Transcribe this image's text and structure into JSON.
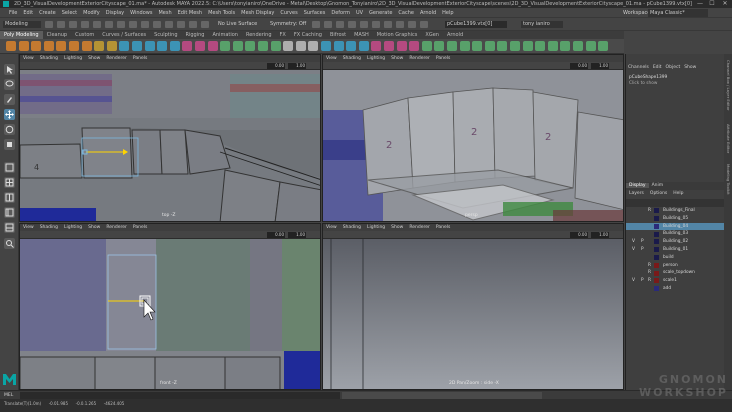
{
  "window": {
    "title": "2D_3D_VisualDevelopmentExteriorCityscape_01.ma* - Autodesk MAYA 2022.5: C:\\Users\\tonyianiro\\OneDrive - Metal\\Desktop\\Gnomon_Tonyianiro\\2D_3D_VisualDevelopmentExteriorCityscape\\scenes\\2D_3D_VisualDevelopmentExteriorCityscape_01.ma - pCube1399.vtx[0]",
    "min_glyph": "—",
    "max_glyph": "☐",
    "close_glyph": "✕"
  },
  "menubar": {
    "items": [
      "File",
      "Edit",
      "Create",
      "Select",
      "Modify",
      "Display",
      "Windows",
      "Mesh",
      "Edit Mesh",
      "Mesh Tools",
      "Mesh Display",
      "Curves",
      "Surfaces",
      "Deform",
      "UV",
      "Generate",
      "Cache",
      "Arnold",
      "Help"
    ],
    "workspace_label": "Workspace:",
    "workspace_value": "Maya Classic*"
  },
  "statusline": {
    "mode": "Modeling",
    "no_live_surface": "No Live Surface",
    "symmetry": "Symmetry: Off",
    "object_field": "pCube1399.vtx[0]",
    "account": "tony ianiro"
  },
  "shelf": {
    "tabs": [
      "Poly Modeling",
      "Cleanup",
      "Custom",
      "Curves / Surfaces",
      "Sculpting",
      "Rigging",
      "Animation",
      "Rendering",
      "FX",
      "FX Caching",
      "Bifrost",
      "MASH",
      "Motion Graphics",
      "XGen",
      "Arnold"
    ],
    "active_tab": 0
  },
  "viewports": {
    "menu": [
      "View",
      "Shading",
      "Lighting",
      "Show",
      "Renderer",
      "Panels"
    ],
    "field_a": "0.00",
    "field_b": "1.00",
    "top_label": "top -Z",
    "persp_label": "persp",
    "front_label": "front -Z",
    "pan_label": "2D Pan/Zoom : side -X"
  },
  "channel_box": {
    "tabs": [
      "Channels",
      "Edit",
      "Object",
      "Show"
    ],
    "object_name": "pCubeShape1399",
    "hint": "Click to show"
  },
  "layer_editor": {
    "tabs": [
      "Display",
      "Anim"
    ],
    "menu": [
      "Layers",
      "Options",
      "Help"
    ],
    "layers": [
      {
        "v": "",
        "p": "",
        "r": "R",
        "color": "#1a1a4a",
        "name": "Buildings_Final",
        "selected": false
      },
      {
        "v": "",
        "p": "",
        "r": "",
        "color": "#1a1a4a",
        "name": "Building_05",
        "selected": false
      },
      {
        "v": "",
        "p": "",
        "r": "",
        "color": "#2a2a7a",
        "name": "Building_04",
        "selected": true
      },
      {
        "v": "",
        "p": "",
        "r": "",
        "color": "#1a1a4a",
        "name": "Building_03",
        "selected": false
      },
      {
        "v": "V",
        "p": "P",
        "r": "",
        "color": "#1a1a4a",
        "name": "Building_02",
        "selected": false
      },
      {
        "v": "V",
        "p": "P",
        "r": "",
        "color": "#1a1a4a",
        "name": "Building_01",
        "selected": false
      },
      {
        "v": "",
        "p": "",
        "r": "",
        "color": "#1a1a4a",
        "name": "build",
        "selected": false
      },
      {
        "v": "",
        "p": "",
        "r": "R",
        "color": "#7a1a1a",
        "name": "person",
        "selected": false
      },
      {
        "v": "",
        "p": "",
        "r": "R",
        "color": "#7a1a1a",
        "name": "scale_topdown",
        "selected": false
      },
      {
        "v": "V",
        "p": "P",
        "r": "R",
        "color": "#7a1a1a",
        "name": "scale1",
        "selected": false
      },
      {
        "v": "",
        "p": "",
        "r": "",
        "color": "#2a2a7a",
        "name": "add",
        "selected": false
      }
    ]
  },
  "side_tabs": [
    "Channel Box / Layer Editor",
    "Attribute Editor",
    "Modeling Toolkit"
  ],
  "commandline": {
    "label": "MEL"
  },
  "helpline": {
    "text": "Translate(T)(1.0m)      -0.01.985      -0.0.1.265      -4624.405"
  },
  "watermark": {
    "brand": "GNOMON",
    "sub": "WORKSHOP"
  },
  "colors": {
    "accent": "#5285a6",
    "maya_logo": "#0aa5a5"
  },
  "icons": [
    "select-icon",
    "lasso-icon",
    "paint-icon",
    "move-icon",
    "rotate-icon",
    "scale-icon",
    "layout-icon",
    "maya-logo-icon"
  ]
}
